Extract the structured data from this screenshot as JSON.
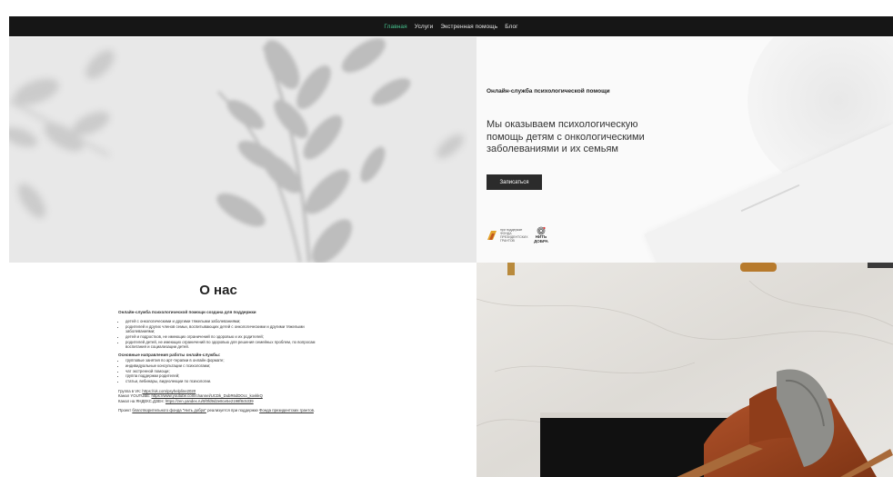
{
  "nav": {
    "items": [
      {
        "label": "Главная",
        "active": true
      },
      {
        "label": "Услуги",
        "active": false
      },
      {
        "label": "Экстренная помощь",
        "active": false
      },
      {
        "label": "Блог",
        "active": false
      }
    ]
  },
  "hero": {
    "kicker": "Онлайн-служба психологической помощи",
    "headline": "Мы оказываем психологическую помощь детям с онкологическими заболеваниями и их семьям",
    "button_label": "Записаться",
    "logo_fpg_text": "при поддержке ФОНДА ПРЕЗИДЕНТСКИХ ГРАНТОВ",
    "logo_nd_line1": "НИТЬ",
    "logo_nd_line2": "ДОБРА"
  },
  "about": {
    "title": "О нас",
    "intro": "Онлайн-служба психологической помощи создана для поддержки",
    "audience": [
      "детей с онкологическими и другими тяжелыми заболеваниями;",
      "родителей и других членов семьи, воспитывающих детей с онкологическими и другими тяжелыми заболеваниями;",
      "детей и подростков, не имеющих ограничений по здоровью и их родителей;",
      "родителей детей, не имеющих ограничений по здоровью для решения семейных проблем, по вопросам воспитания и социализации детей."
    ],
    "directions_title": "Основные направления работы онлайн-службы:",
    "directions": [
      "групповые занятия по арт-терапии в онлайн формате;",
      "индивидуальные консультации с психологами;",
      "чат экстренной помощи;",
      "группа поддержки родителей;",
      "статьи, вебинары, видеолекции по психологии."
    ],
    "vk_prefix": "Группа в VK: ",
    "vk_link": "https://vk.com/psyhelpline2020",
    "yt_prefix": "Канал YOUTUBE: ",
    "yt_link": "https://www.youtube.com/channel/UCDk_DubR6dDOcc_kovkkQ",
    "zen_prefix": "Канал на ЯНДЕКС.ДЗЕН: ",
    "zen_link": "https://zen.yandex.ru/5f0fd9d2e8ce5e2198f8c5339",
    "project_prefix": "Проект ",
    "project_link": "благотворительного фонда \"Нить добра\"",
    "project_mid": " реализуется при поддержке ",
    "project_link2": "Фонда президентских грантов",
    "project_suffix": "."
  },
  "colors": {
    "nav_bg": "#161616",
    "nav_active": "#46c28e",
    "button_bg": "#2b2b2b"
  }
}
